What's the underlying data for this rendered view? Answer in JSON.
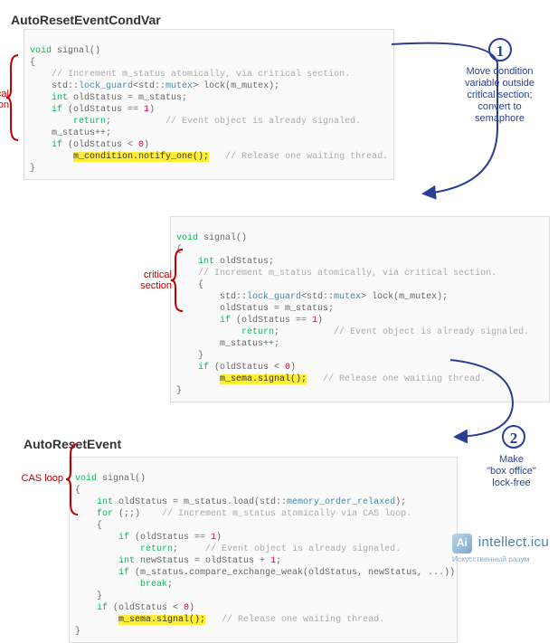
{
  "diagram": {
    "block1": {
      "title": "AutoResetEventCondVar",
      "brace_label": "critical\nsection",
      "code": {
        "l0": "void",
        "l0b": " signal()",
        "l1": "{",
        "l2": "    ",
        "c2": "// Increment m_status atomically, via critical section.",
        "l3a": "    std::",
        "l3b": "lock_guard",
        "l3c": "<std::",
        "l3d": "mutex",
        "l3e": "> lock(m_mutex);",
        "l4a": "    int",
        "l4b": " oldStatus = m_status;",
        "l5a": "    if",
        "l5b": " (oldStatus == ",
        "l5c": "1",
        "l5d": ")",
        "l6a": "        return",
        "l6b": ";          ",
        "c6": "// Event object is already signaled.",
        "l7": "    m_status++;",
        "l8a": "    if",
        "l8b": " (oldStatus < ",
        "l8c": "0",
        "l8d": ")",
        "l9a": "        ",
        "l9h": "m_condition.notify_one();",
        "l9b": "   ",
        "c9": "// Release one waiting thread.",
        "l10": "}"
      }
    },
    "step1": {
      "num": "1",
      "note": "Move condition\nvariable outside\ncritical section;\nconvert to\nsemaphore"
    },
    "block2": {
      "brace_label": "critical\nsection",
      "code": {
        "l0": "void",
        "l0b": " signal()",
        "l1": "{",
        "l2a": "    int",
        "l2b": " oldStatus;",
        "l3": "    ",
        "c3": "// Increment m_status atomically, via critical section.",
        "l4": "    {",
        "l5a": "        std::",
        "l5b": "lock_guard",
        "l5c": "<std::",
        "l5d": "mutex",
        "l5e": "> lock(m_mutex);",
        "l6": "        oldStatus = m_status;",
        "l7a": "        if",
        "l7b": " (oldStatus == ",
        "l7c": "1",
        "l7d": ")",
        "l8a": "            return",
        "l8b": ";          ",
        "c8": "// Event object is already signaled.",
        "l9": "        m_status++;",
        "l10": "    }",
        "l11a": "    if",
        "l11b": " (oldStatus < ",
        "l11c": "0",
        "l11d": ")",
        "l12a": "        ",
        "l12h": "m_sema.signal();",
        "l12b": "   ",
        "c12": "// Release one waiting thread.",
        "l13": "}"
      }
    },
    "step2": {
      "num": "2",
      "note": "Make\n\"box office\"\nlock-free"
    },
    "block3": {
      "title": "AutoResetEvent",
      "brace_label": "CAS loop",
      "code": {
        "l0": "void",
        "l0b": " signal()",
        "l1": "{",
        "l2a": "    int",
        "l2b": " oldStatus = m_status.load(std::",
        "l2c": "memory_order_relaxed",
        "l2d": ");",
        "l3a": "    for",
        "l3b": " (;;)    ",
        "c3": "// Increment m_status atomically via CAS loop.",
        "l4": "    {",
        "l5a": "        if",
        "l5b": " (oldStatus == ",
        "l5c": "1",
        "l5d": ")",
        "l6a": "            return",
        "l6b": ";     ",
        "c6": "// Event object is already signaled.",
        "l7a": "        int",
        "l7b": " newStatus = oldStatus + ",
        "l7c": "1",
        "l7d": ";",
        "l8a": "        if",
        "l8b": " (m_status.compare_exchange_weak(oldStatus, newStatus, ...))",
        "l9a": "            break",
        "l9b": ";",
        "l10": "    }",
        "l11a": "    if",
        "l11b": " (oldStatus < ",
        "l11c": "0",
        "l11d": ")",
        "l12a": "        ",
        "l12h": "m_sema.signal();",
        "l12b": "   ",
        "c12": "// Release one waiting thread.",
        "l13": "}"
      }
    }
  },
  "watermark": {
    "main": "intellect.icu",
    "sub": "Искусственный разум"
  }
}
